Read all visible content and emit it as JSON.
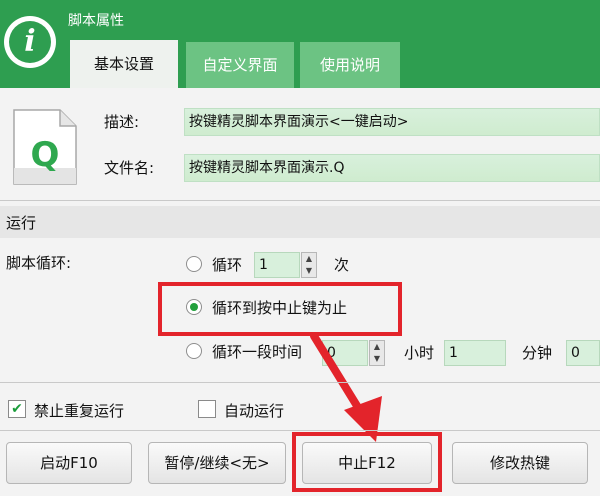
{
  "window": {
    "title": "脚本属性"
  },
  "tabs": [
    {
      "label": "基本设置",
      "active": true
    },
    {
      "label": "自定义界面",
      "active": false
    },
    {
      "label": "使用说明",
      "active": false
    }
  ],
  "fields": {
    "desc_label": "描述:",
    "desc_value": "按键精灵脚本界面演示<一键启动>",
    "filename_label": "文件名:",
    "filename_value": "按键精灵脚本界面演示.Q"
  },
  "file_icon_letter": "Q",
  "run": {
    "section_title": "运行",
    "loop_label": "脚本循环:",
    "opt1_label": "循环",
    "opt1_value": "1",
    "opt1_unit": "次",
    "opt2_label": "循环到按中止键为止",
    "opt3_label": "循环一段时间",
    "opt3_hours": "0",
    "opt3_hours_unit": "小时",
    "opt3_minutes": "1",
    "opt3_minutes_unit": "分钟",
    "opt3_seconds": "0",
    "selected_option": "opt2"
  },
  "checkboxes": {
    "no_repeat_label": "禁止重复运行",
    "no_repeat_checked": true,
    "auto_run_label": "自动运行",
    "auto_run_checked": false
  },
  "buttons": {
    "start": "启动F10",
    "pause": "暂停/继续<无>",
    "stop": "中止F12",
    "hotkey": "修改热键"
  },
  "colors": {
    "brand_green": "#2e9e50",
    "highlight_red": "#e3242b"
  }
}
